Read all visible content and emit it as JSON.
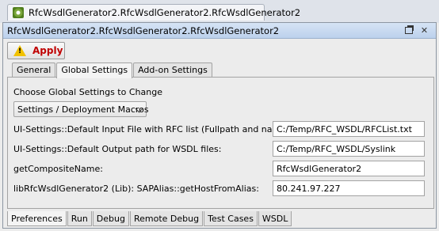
{
  "doc_tab": {
    "label": "RfcWsdlGenerator2.RfcWsdlGenerator2.RfcWsdlGenerator2"
  },
  "window": {
    "title": "RfcWsdlGenerator2.RfcWsdlGenerator2.RfcWsdlGenerator2"
  },
  "toolbar": {
    "apply_label": "Apply"
  },
  "tabs": [
    {
      "label": "General",
      "selected": false
    },
    {
      "label": "Global Settings",
      "selected": true
    },
    {
      "label": "Add-on Settings",
      "selected": false
    }
  ],
  "settings": {
    "section_label": "Choose Global Settings to Change",
    "dropdown_value": "Settings / Deployment Macros",
    "rows": [
      {
        "label": "UI-Settings::Default Input File with RFC list (Fullpath and name):",
        "value": "C:/Temp/RFC_WSDL/RFCList.txt"
      },
      {
        "label": "UI-Settings::Default Output path for WSDL files:",
        "value": "C:/Temp/RFC_WSDL/Syslink"
      },
      {
        "label": "getCompositeName:",
        "value": "RfcWsdlGenerator2"
      },
      {
        "label": "libRfcWsdlGenerator2 (Lib): SAPAlias::getHostFromAlias:",
        "value": "80.241.97.227"
      }
    ]
  },
  "bottom_tabs": [
    {
      "label": "Preferences",
      "selected": true
    },
    {
      "label": "Run",
      "selected": false
    },
    {
      "label": "Debug",
      "selected": false
    },
    {
      "label": "Remote Debug",
      "selected": false
    },
    {
      "label": "Test Cases",
      "selected": false
    },
    {
      "label": "WSDL",
      "selected": false
    }
  ],
  "colors": {
    "apply": "#c00000",
    "title_bar": "#c8daf0",
    "warning": "#f2c200"
  }
}
